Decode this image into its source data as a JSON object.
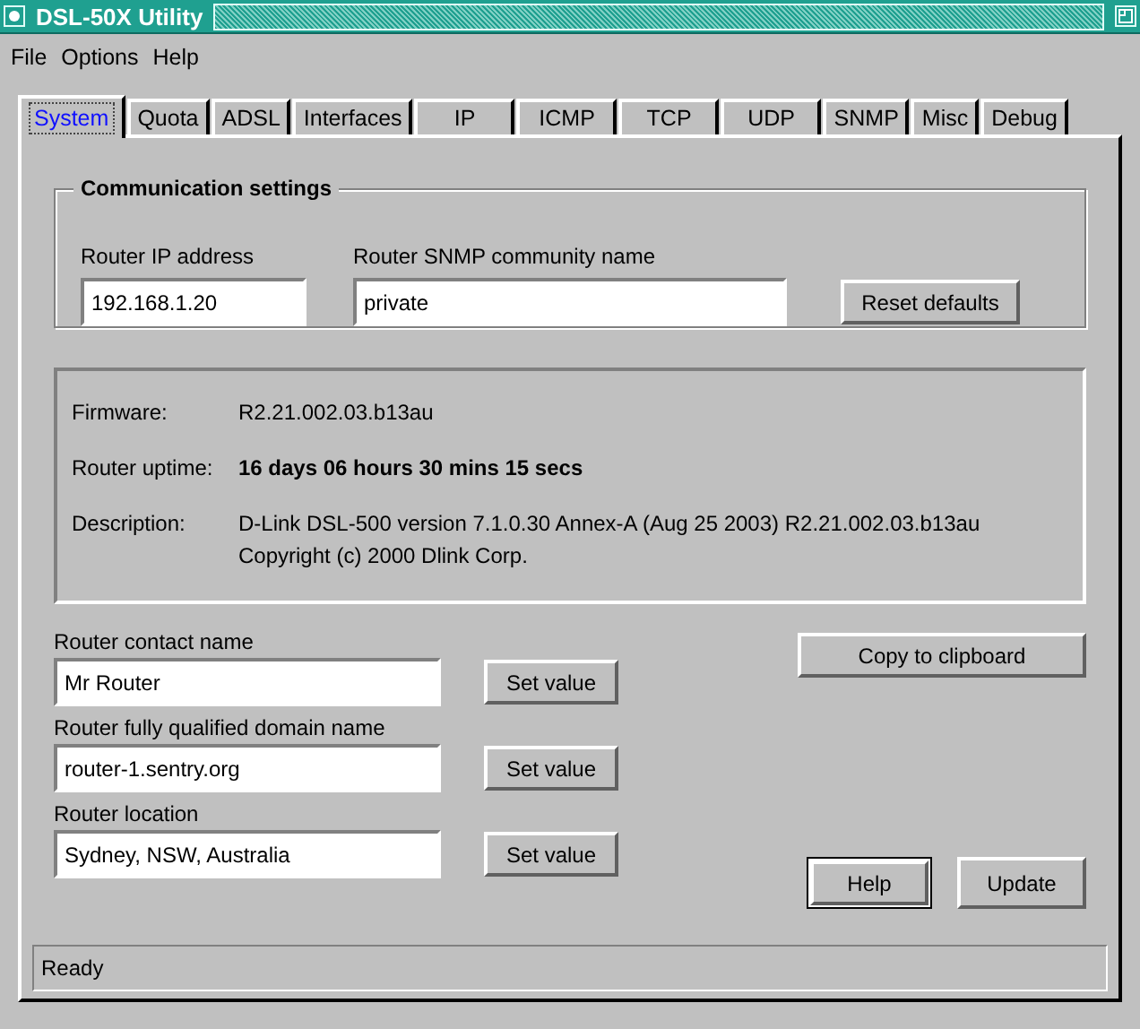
{
  "window": {
    "title": "DSL-50X Utility"
  },
  "menu": [
    "File",
    "Options",
    "Help"
  ],
  "tabs": [
    {
      "label": "System",
      "selected": true
    },
    {
      "label": "Quota",
      "selected": false
    },
    {
      "label": "ADSL",
      "selected": false
    },
    {
      "label": "Interfaces",
      "selected": false
    },
    {
      "label": "IP",
      "selected": false
    },
    {
      "label": "ICMP",
      "selected": false
    },
    {
      "label": "TCP",
      "selected": false
    },
    {
      "label": "UDP",
      "selected": false
    },
    {
      "label": "SNMP",
      "selected": false
    },
    {
      "label": "Misc",
      "selected": false
    },
    {
      "label": "Debug",
      "selected": false
    }
  ],
  "communication": {
    "title": "Communication settings",
    "ip_label": "Router IP address",
    "ip_value": "192.168.1.20",
    "community_label": "Router SNMP community name",
    "community_value": "private",
    "reset_button": "Reset defaults"
  },
  "info": [
    {
      "label": "Firmware:",
      "value": "R2.21.002.03.b13au",
      "bold": false
    },
    {
      "label": "Router uptime:",
      "value": "16 days 06 hours 30 mins 15 secs",
      "bold": true
    },
    {
      "label": "Description:",
      "value": "D-Link DSL-500 version 7.1.0.30 Annex-A (Aug 25 2003) R2.21.002.03.b13au",
      "bold": false
    },
    {
      "value": "Copyright (c) 2000 Dlink Corp.",
      "bold": false
    }
  ],
  "settings": [
    {
      "label": "Router contact name",
      "value": "Mr Router",
      "button": "Set value"
    },
    {
      "label": "Router fully qualified domain name",
      "value": "router-1.sentry.org",
      "button": "Set value"
    },
    {
      "label": "Router location",
      "value": "Sydney, NSW, Australia",
      "button": "Set value"
    }
  ],
  "copy_button": "Copy to clipboard",
  "buttons": [
    {
      "label": "Help",
      "default": true
    },
    {
      "label": "Update",
      "default": false
    }
  ],
  "status_bar": "Ready"
}
